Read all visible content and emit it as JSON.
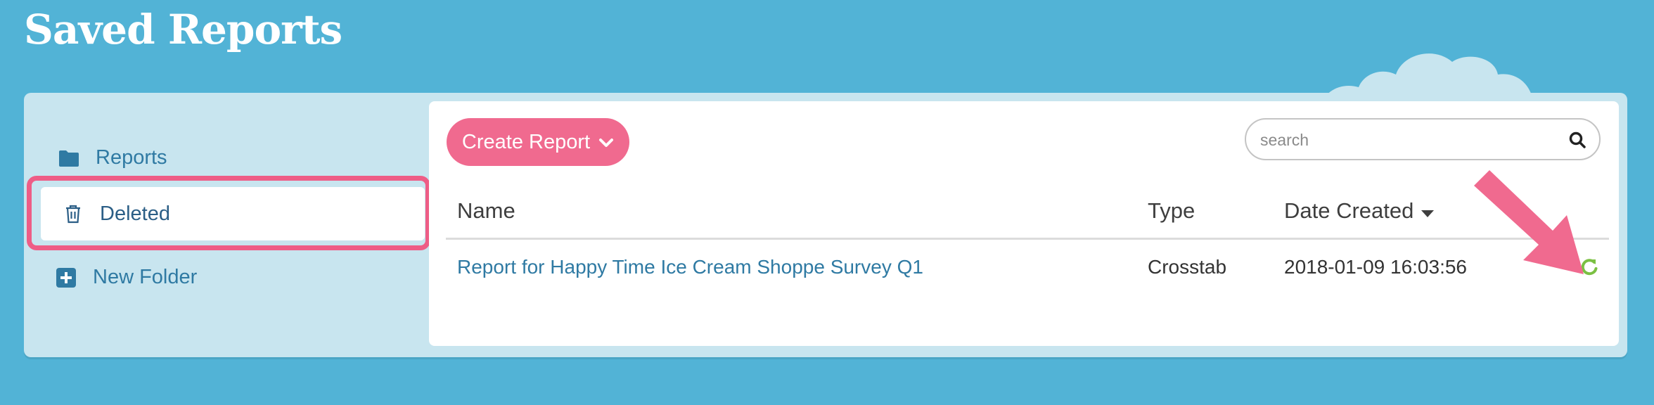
{
  "page": {
    "title": "Saved Reports"
  },
  "sidebar": {
    "items": [
      {
        "label": "Reports",
        "icon": "folder-icon"
      },
      {
        "label": "Deleted",
        "icon": "trash-icon",
        "selected": true
      },
      {
        "label": "New Folder",
        "icon": "plus-square-icon"
      }
    ]
  },
  "toolbar": {
    "create_label": "Create Report",
    "search_placeholder": "search",
    "search_value": ""
  },
  "table": {
    "columns": [
      "Name",
      "Type",
      "Date Created"
    ],
    "sort": {
      "column": "Date Created",
      "direction": "desc"
    },
    "rows": [
      {
        "name": "Report for Happy Time Ice Cream Shoppe Survey Q1",
        "type": "Crosstab",
        "date": "2018-01-09 16:03:56",
        "action_icon": "restore-icon"
      }
    ]
  },
  "colors": {
    "background": "#52b3d6",
    "panel": "#c8e5ef",
    "accent_pink": "#f06a8f",
    "link": "#2f7aa3",
    "restore_green": "#7bc043"
  }
}
